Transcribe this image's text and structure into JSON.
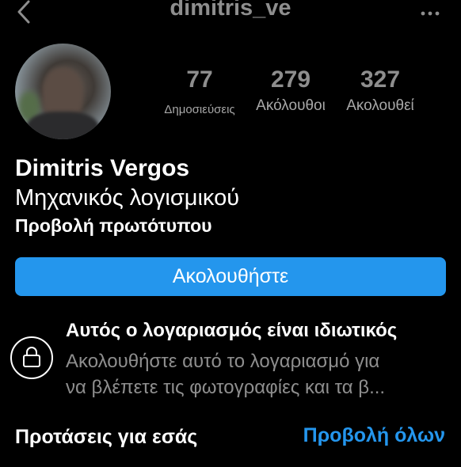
{
  "header": {
    "username": "dimitris_ve",
    "back_icon": "chevron-left-icon",
    "more_icon": "more-horizontal-icon"
  },
  "profile": {
    "stats": [
      {
        "value": "77",
        "label": "Δημοσιεύσεις"
      },
      {
        "value": "279",
        "label": "Ακόλουθοι"
      },
      {
        "value": "327",
        "label": "Ακολουθεί"
      }
    ],
    "display_name": "Dimitris Vergos",
    "bio": "Μηχανικός λογισμικού",
    "view_original": "Προβολή πρωτότυπου"
  },
  "follow_button": {
    "label": "Ακολουθήστε",
    "color": "#2496ed"
  },
  "private_notice": {
    "icon": "lock-icon",
    "title": "Αυτός ο λογαριασμός είναι ιδιωτικός",
    "desc_line1": "Ακολουθήστε αυτό το λογαριασμό για",
    "desc_line2": "να βλέπετε τις φωτογραφίες και τα β..."
  },
  "suggestions": {
    "title": "Προτάσεις για εσάς",
    "view_all": "Προβολή όλων"
  }
}
